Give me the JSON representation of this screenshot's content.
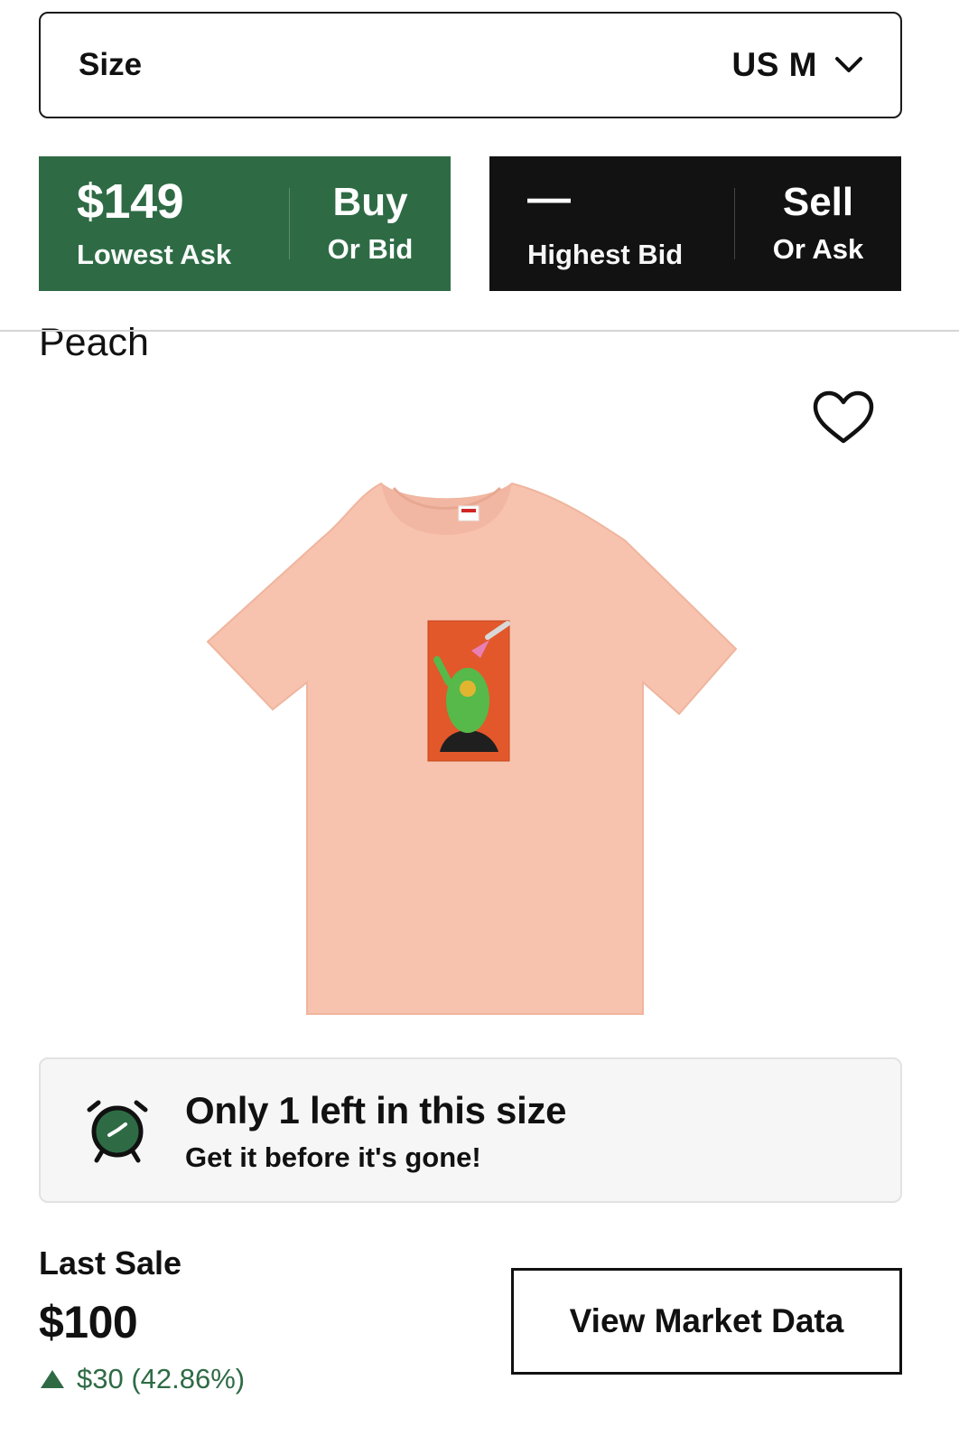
{
  "size_selector": {
    "label": "Size",
    "value": "US M",
    "icon": "chevron-down-icon"
  },
  "buy_panel": {
    "price": "$149",
    "price_label": "Lowest Ask",
    "button_title": "Buy",
    "button_subtitle": "Or Bid",
    "color": "#2e6b45"
  },
  "sell_panel": {
    "price": "—",
    "price_label": "Highest Bid",
    "button_title": "Sell",
    "button_subtitle": "Or Ask",
    "color": "#121212"
  },
  "product": {
    "color_name": "Peach",
    "favorite_icon": "heart-outline-icon",
    "image_alt": "Peach T-shirt with graphic print"
  },
  "stock_notice": {
    "icon": "alarm-clock-icon",
    "title": "Only 1 left in this size",
    "subtitle": "Get it before it's gone!"
  },
  "last_sale": {
    "label": "Last Sale",
    "price": "$100",
    "change": "$30 (42.86%)",
    "change_icon": "triangle-up-icon",
    "change_color": "#2e6b45"
  },
  "market_data_button": {
    "label": "View Market Data"
  }
}
